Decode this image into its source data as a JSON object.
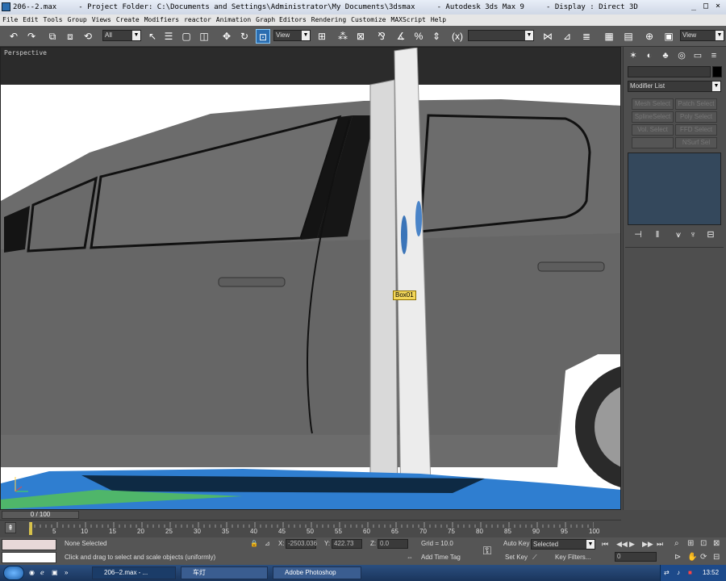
{
  "window": {
    "title": "206--2.max     - Project Folder: C:\\Documents and Settings\\Administrator\\My Documents\\3dsmax     - Autodesk 3ds Max 9     - Display : Direct 3D"
  },
  "menu": [
    "File",
    "Edit",
    "Tools",
    "Group",
    "Views",
    "Create",
    "Modifiers",
    "reactor",
    "Animation",
    "Graph Editors",
    "Rendering",
    "Customize",
    "MAXScript",
    "Help"
  ],
  "toolbar": {
    "selection_filter": "All",
    "ref_coord": "View",
    "named_selection": "",
    "view_dropdown": "View"
  },
  "viewport": {
    "label": "Perspective",
    "object_tooltip": "Box01"
  },
  "command_panel": {
    "modifier_list": "Modifier List",
    "buttons": [
      "Mesh Select",
      "Patch Select",
      "SplineSelect",
      "Poly Select",
      "Vol. Select",
      "FFD Select",
      "",
      "NSurf Sel"
    ]
  },
  "time": {
    "slider": "0 / 100",
    "ticks": [
      "0",
      "5",
      "10",
      "15",
      "20",
      "25",
      "30",
      "35",
      "40",
      "45",
      "50",
      "55",
      "60",
      "65",
      "70",
      "75",
      "80",
      "85",
      "90",
      "95",
      "100"
    ]
  },
  "status": {
    "selection": "None Selected",
    "prompt": "Click and drag to select and scale objects (uniformly)",
    "x_label": "X:",
    "x_value": "-2503.036",
    "y_label": "Y:",
    "y_value": "422.73",
    "z_label": "Z:",
    "z_value": "0.0",
    "grid": "Grid = 10.0",
    "add_time_tag": "Add Time Tag",
    "auto_key": "Auto Key",
    "auto_key_mode": "Selected",
    "set_key": "Set Key",
    "key_filters": "Key Filters...",
    "frame": "0"
  },
  "taskbar": {
    "items": [
      "206--2.max     - ...",
      "车灯",
      "Adobe Photoshop"
    ],
    "clock": "13:52"
  },
  "colors": {
    "car_body": "#6b6b6b",
    "car_shadow": "#5a5a5a",
    "tooltip": "#f3d75a",
    "ui_dark": "#4e4e4e",
    "panel_blue": "#34485c"
  }
}
